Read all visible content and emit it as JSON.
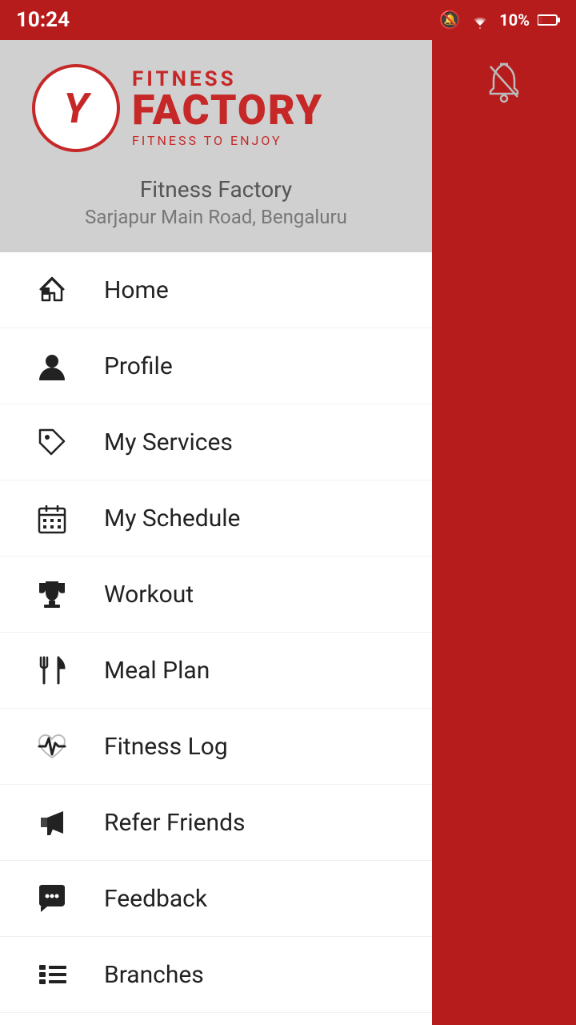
{
  "statusBar": {
    "time": "10:24",
    "batteryText": "10%"
  },
  "header": {
    "gymName": "Fitness Factory",
    "gymAddress": "Sarjapur Main Road, Bengaluru",
    "logoY": "Y",
    "logoFitness": "FITNESS",
    "logoFactory": "FACTORY",
    "logoTagline": "FITNESS TO ENJOY"
  },
  "navItems": [
    {
      "id": "home",
      "label": "Home",
      "icon": "home"
    },
    {
      "id": "profile",
      "label": "Profile",
      "icon": "person"
    },
    {
      "id": "my-services",
      "label": "My Services",
      "icon": "tag"
    },
    {
      "id": "my-schedule",
      "label": "My Schedule",
      "icon": "calendar"
    },
    {
      "id": "workout",
      "label": "Workout",
      "icon": "trophy"
    },
    {
      "id": "meal-plan",
      "label": "Meal Plan",
      "icon": "fork-knife"
    },
    {
      "id": "fitness-log",
      "label": "Fitness Log",
      "icon": "heartbeat"
    },
    {
      "id": "refer-friends",
      "label": "Refer Friends",
      "icon": "megaphone"
    },
    {
      "id": "feedback",
      "label": "Feedback",
      "icon": "chat"
    },
    {
      "id": "branches",
      "label": "Branches",
      "icon": "list"
    }
  ]
}
